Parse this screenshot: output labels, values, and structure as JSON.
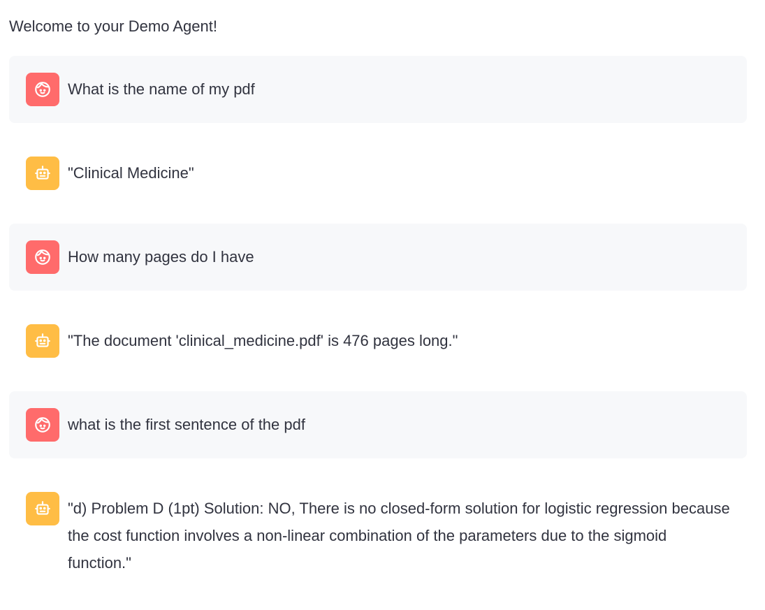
{
  "header": {
    "welcome": "Welcome to your Demo Agent!"
  },
  "messages": [
    {
      "role": "user",
      "avatar_icon": "face-icon",
      "text": "What is the name of my pdf"
    },
    {
      "role": "assistant",
      "avatar_icon": "robot-icon",
      "text": "\"Clinical Medicine\""
    },
    {
      "role": "user",
      "avatar_icon": "face-icon",
      "text": "How many pages do I have"
    },
    {
      "role": "assistant",
      "avatar_icon": "robot-icon",
      "text": "\"The document 'clinical_medicine.pdf' is 476 pages long.\""
    },
    {
      "role": "user",
      "avatar_icon": "face-icon",
      "text": "what is the first sentence of the pdf"
    },
    {
      "role": "assistant",
      "avatar_icon": "robot-icon",
      "text": "\"d) Problem D (1pt) Solution: NO, There is no closed-form solution for logistic regression because the cost function involves a non-linear combination of the parameters due to the sigmoid function.\""
    }
  ],
  "colors": {
    "user_avatar": "#ff6b6b",
    "assistant_avatar": "#ffbd45",
    "user_bubble": "#f7f8fa",
    "text": "#31333f"
  }
}
